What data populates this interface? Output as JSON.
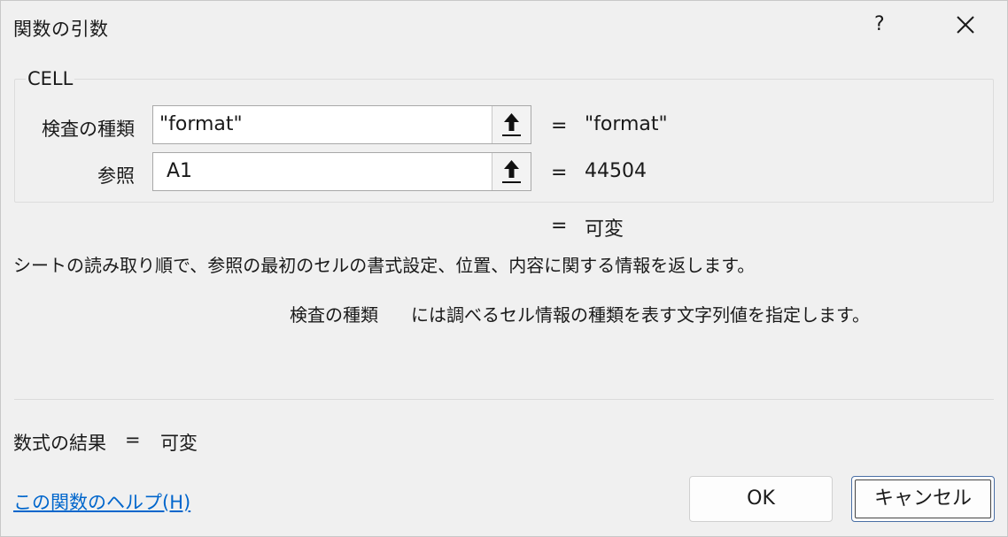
{
  "dialog": {
    "title": "関数の引数",
    "help_button": "?",
    "close_icon": "close-icon"
  },
  "function": {
    "name": "CELL",
    "arguments": [
      {
        "label": "検査の種類",
        "value": "\"format\"",
        "result": "\"format\""
      },
      {
        "label": "参照",
        "value": "A1",
        "result": "44504"
      }
    ],
    "overall_eq": "=",
    "overall_result": "可変",
    "description": "シートの読み取り順で、参照の最初のセルの書式設定、位置、内容に関する情報を返します。",
    "arg_desc_name": "検査の種類",
    "arg_desc_text": "には調べるセル情報の種類を表す文字列値を指定します。"
  },
  "formula_result": {
    "label": "数式の結果",
    "eq": "=",
    "value": "可変"
  },
  "footer": {
    "help_link": "この関数のヘルプ(H)",
    "ok_label": "OK",
    "cancel_label": "キャンセル"
  },
  "eq_sign": "=",
  "colors": {
    "background": "#f0f0f0",
    "link": "#0066cc",
    "focus_border": "#4a6fa5"
  }
}
